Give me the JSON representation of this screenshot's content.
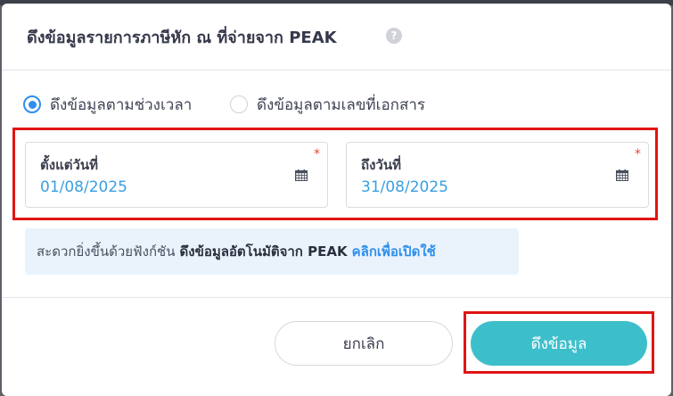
{
  "dialog": {
    "title": "ดึงข้อมูลรายการภาษีหัก ณ ที่จ่ายจาก PEAK",
    "help_icon": "?"
  },
  "mode": {
    "options": [
      {
        "label": "ดึงข้อมูลตามช่วงเวลา",
        "selected": true
      },
      {
        "label": "ดึงข้อมูลตามเลขที่เอกสาร",
        "selected": false
      }
    ]
  },
  "date_range": {
    "from": {
      "label": "ตั้งแต่วันที่",
      "value": "01/08/2025",
      "required_mark": "*",
      "icon": "calendar-icon"
    },
    "to": {
      "label": "ถึงวันที่",
      "value": "31/08/2025",
      "required_mark": "*",
      "icon": "calendar-icon"
    }
  },
  "banner": {
    "text": "สะดวกยิ่งขึ้นด้วยฟังก์ชัน",
    "feature": "ดึงข้อมูลอัตโนมัติจาก PEAK",
    "link": "คลิกเพื่อเปิดใช้"
  },
  "footer": {
    "cancel_label": "ยกเลิก",
    "fetch_label": "ดึงข้อมูล"
  },
  "colors": {
    "accent": "#2f8fea",
    "primary_button": "#3dbfcb",
    "highlight_frame": "#e01414",
    "required": "#e5483b"
  }
}
